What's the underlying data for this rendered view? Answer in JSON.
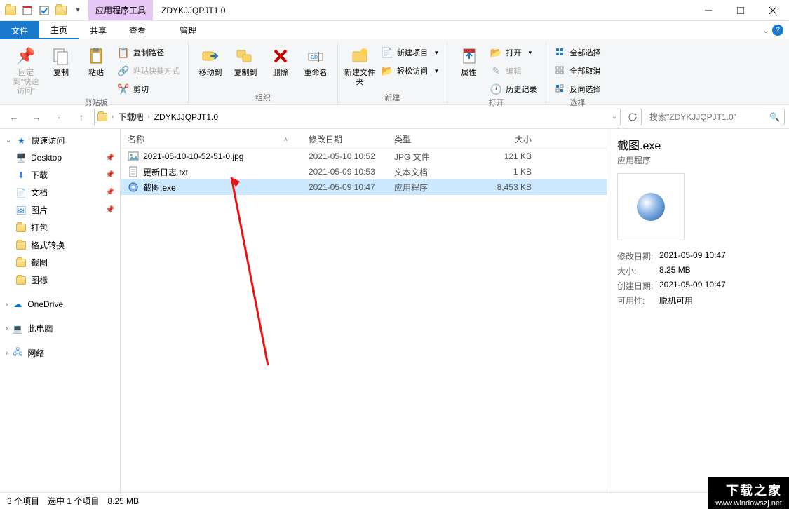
{
  "window": {
    "context_tab": "应用程序工具",
    "title": "ZDYKJJQPJT1.0"
  },
  "ribbon_tabs": {
    "file": "文件",
    "home": "主页",
    "share": "共享",
    "view": "查看",
    "manage": "管理"
  },
  "ribbon": {
    "pin": "固定到\"快速访问\"",
    "copy": "复制",
    "paste": "粘贴",
    "copy_path": "复制路径",
    "paste_shortcut": "粘贴快捷方式",
    "cut": "剪切",
    "group_clipboard": "剪贴板",
    "move_to": "移动到",
    "copy_to": "复制到",
    "delete": "删除",
    "rename": "重命名",
    "group_organize": "组织",
    "new_folder": "新建文件夹",
    "new_item": "新建项目",
    "easy_access": "轻松访问",
    "group_new": "新建",
    "properties": "属性",
    "open": "打开",
    "edit": "编辑",
    "history": "历史记录",
    "group_open": "打开",
    "select_all": "全部选择",
    "select_none": "全部取消",
    "invert": "反向选择",
    "group_select": "选择"
  },
  "address": {
    "seg1": "下载吧",
    "seg2": "ZDYKJJQPJT1.0",
    "search_placeholder": "搜索\"ZDYKJJQPJT1.0\""
  },
  "sidebar": {
    "quick": "快速访问",
    "desktop": "Desktop",
    "downloads": "下载",
    "documents": "文档",
    "pictures": "图片",
    "dabao": "打包",
    "geshi": "格式转换",
    "jietu": "截图",
    "tubiao": "图标",
    "onedrive": "OneDrive",
    "thispc": "此电脑",
    "network": "网络"
  },
  "columns": {
    "name": "名称",
    "date": "修改日期",
    "type": "类型",
    "size": "大小"
  },
  "files": [
    {
      "name": "2021-05-10-10-52-51-0.jpg",
      "date": "2021-05-10 10:52",
      "type": "JPG 文件",
      "size": "121 KB",
      "icon": "image",
      "selected": false
    },
    {
      "name": "更新日志.txt",
      "date": "2021-05-09 10:53",
      "type": "文本文档",
      "size": "1 KB",
      "icon": "text",
      "selected": false
    },
    {
      "name": "截图.exe",
      "date": "2021-05-09 10:47",
      "type": "应用程序",
      "size": "8,453 KB",
      "icon": "exe",
      "selected": true
    }
  ],
  "preview": {
    "title": "截图.exe",
    "type": "应用程序",
    "labels": {
      "modified": "修改日期:",
      "size": "大小:",
      "created": "创建日期:",
      "avail": "可用性:"
    },
    "modified": "2021-05-09 10:47",
    "size": "8.25 MB",
    "created": "2021-05-09 10:47",
    "avail": "脱机可用"
  },
  "status": {
    "count": "3 个项目",
    "selected": "选中 1 个项目",
    "selsize": "8.25 MB"
  },
  "watermark": {
    "line1": "下载之家",
    "line2": "www.windowszj.net"
  }
}
